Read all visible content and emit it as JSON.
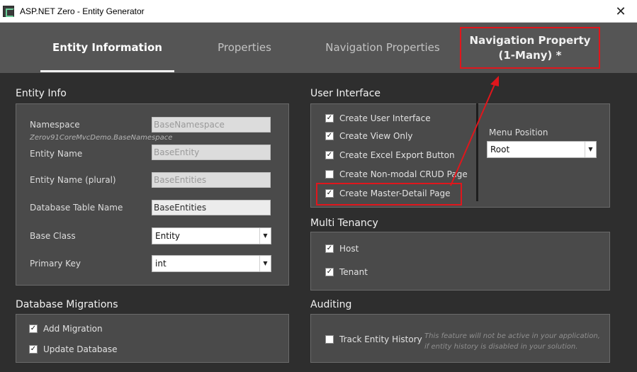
{
  "window": {
    "title": "ASP.NET Zero - Entity Generator",
    "close_glyph": "✕"
  },
  "tabs": [
    {
      "label": "Entity Information"
    },
    {
      "label": "Properties"
    },
    {
      "label": "Navigation Properties"
    },
    {
      "line1": "Navigation Property",
      "line2": "(1-Many) *"
    }
  ],
  "entity_info": {
    "title": "Entity Info",
    "namespace_label": "Namespace",
    "namespace_value": "BaseNamespace",
    "namespace_hint": "Zerov91CoreMvcDemo.BaseNamespace",
    "entity_name_label": "Entity Name",
    "entity_name_value": "BaseEntity",
    "entity_name_plural_label": "Entity Name (plural)",
    "entity_name_plural_value": "BaseEntities",
    "db_table_label": "Database Table Name",
    "db_table_value": "BaseEntities",
    "base_class_label": "Base Class",
    "base_class_value": "Entity",
    "primary_key_label": "Primary Key",
    "primary_key_value": "int"
  },
  "user_interface": {
    "title": "User Interface",
    "options": [
      {
        "label": "Create User Interface",
        "checked": true
      },
      {
        "label": "Create View Only",
        "checked": true
      },
      {
        "label": "Create Excel Export Button",
        "checked": true
      },
      {
        "label": "Create Non-modal CRUD Page",
        "checked": false
      },
      {
        "label": "Create Master-Detail Page",
        "checked": true
      }
    ],
    "menu_position_label": "Menu Position",
    "menu_position_value": "Root"
  },
  "multi_tenancy": {
    "title": "Multi Tenancy",
    "options": [
      {
        "label": "Host",
        "checked": true
      },
      {
        "label": "Tenant",
        "checked": true
      }
    ]
  },
  "db_migrations": {
    "title": "Database Migrations",
    "options": [
      {
        "label": "Add Migration",
        "checked": true
      },
      {
        "label": "Update Database",
        "checked": true
      }
    ]
  },
  "auditing": {
    "title": "Auditing",
    "track_label": "Track Entity History",
    "track_checked": false,
    "hint_line1": "This feature will not be active in your application,",
    "hint_line2": "if entity history is disabled in your solution."
  },
  "glyphs": {
    "check": "✓",
    "dropdown": "▼"
  },
  "colors": {
    "annotation_red": "#e0161c",
    "tab_bg": "#555555",
    "panel_bg": "#4a4a4a",
    "body_bg": "#2e2e2e"
  }
}
